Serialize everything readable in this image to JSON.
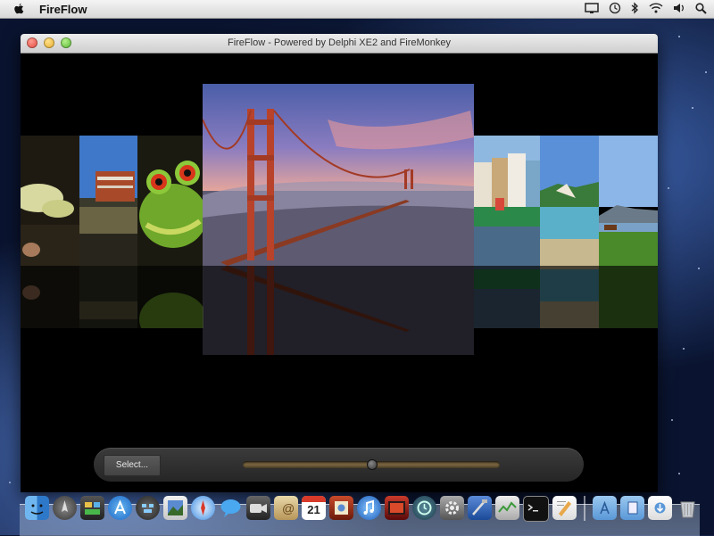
{
  "menubar": {
    "app_name": "FireFlow"
  },
  "window": {
    "title": "FireFlow - Powered by Delphi XE2 and FireMonkey"
  },
  "controls": {
    "select_label": "Select...",
    "slider_position": 0.5
  },
  "coverflow": {
    "photos": [
      "sailboats",
      "ferry-building",
      "frog",
      "golden-gate-bridge",
      "colorful-houses",
      "beach-dunes",
      "park-bench-bay"
    ],
    "selected": "golden-gate-bridge"
  },
  "dock": {
    "icons": [
      "finder",
      "launchpad",
      "dashboard",
      "app-store",
      "mission-control",
      "preview",
      "safari",
      "messages",
      "facetime",
      "contacts",
      "calendar",
      "photo-booth",
      "itunes",
      "photo-slideshow",
      "time-machine",
      "system-preferences",
      "xcode",
      "activity-monitor",
      "terminal",
      "textedit",
      "applications-folder",
      "documents-folder",
      "downloads-stack",
      "trash"
    ],
    "calendar_day": "21"
  },
  "colors": {
    "window_bg": "#000000",
    "desktop": "#1c3366"
  }
}
